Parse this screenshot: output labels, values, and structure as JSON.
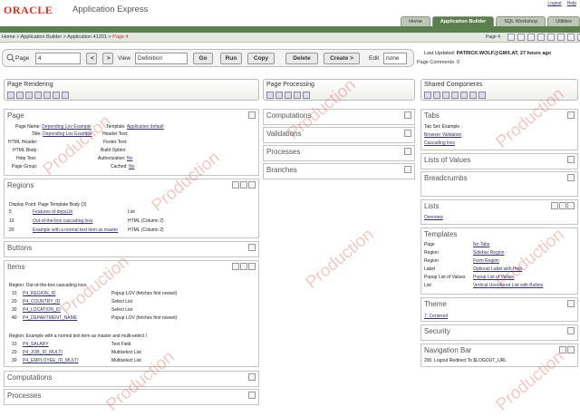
{
  "header": {
    "brand": "ORACLE",
    "app_title": "Application Express",
    "links": [
      "Logout",
      "Help"
    ],
    "tabs": [
      "Home",
      "Application Builder",
      "SQL Workshop",
      "Utilities"
    ]
  },
  "breadcrumb": {
    "path": "Home > Application Builder > Application 41201 >",
    "current": "Page 4",
    "page_tab": "Page 4"
  },
  "toolbar": {
    "page_label": "Page",
    "page_value": "4",
    "view_label": "View",
    "view_value": "Definition",
    "go": "Go",
    "run": "Run",
    "copy": "Copy",
    "delete": "Delete",
    "create": "Create >",
    "edit_label": "Edit",
    "edit_value": "none"
  },
  "status": {
    "last_updated_label": "Last Updated:",
    "last_updated": "PATRICK.WOLF@GMX.AT, 27 hours ago",
    "comments": "Page Comments: 0"
  },
  "page_rendering": {
    "title": "Page Rendering",
    "page": {
      "title": "Page",
      "name_label": "Page Name:",
      "name": "Depending Lov Example",
      "template_label": "Template:",
      "template": "Application default",
      "title_label": "Title:",
      "title_val": "Depending Lov Example",
      "header_text": "Header Text:",
      "html_header": "HTML Header:",
      "footer_text": "Footer Text:",
      "html_body": "HTML Body:",
      "build_option": "Build Option:",
      "help_text": "Help Text:",
      "authorization": "Authorization:",
      "auth_val": "No",
      "page_group": "Page Group:",
      "cached": "Cached:",
      "cached_val": "No"
    },
    "regions": {
      "title": "Regions",
      "display_point": "Display Point: Page Template Body (3)",
      "rows": [
        {
          "seq": "5",
          "name": "Features of depsLib",
          "type": "List"
        },
        {
          "seq": "10",
          "name": "Out-of-the-box cascading lovs",
          "type": "HTML (Column 2)"
        },
        {
          "seq": "20",
          "name": "Example with a normal text item as master",
          "type": "HTML (Column 2)"
        }
      ]
    },
    "buttons": {
      "title": "Buttons"
    },
    "items": {
      "title": "Items",
      "region1": "Region: Out-of-the-box cascading lovs",
      "rows1": [
        {
          "seq": "10",
          "name": "P4_REGION_ID",
          "type": "Popup LOV (fetches first rowset)"
        },
        {
          "seq": "20",
          "name": "P4_COUNTRY_ID",
          "type": "Select List"
        },
        {
          "seq": "30",
          "name": "P4_LOCATION_ID",
          "type": "Select List"
        },
        {
          "seq": "40",
          "name": "P4_DEPARTMENT_NAME",
          "type": "Popup LOV (fetches first rowset)"
        }
      ],
      "region2": "Region: Example with a normal text item as master and multi-select l",
      "rows2": [
        {
          "seq": "10",
          "name": "P4_SALARY",
          "type": "Text Field"
        },
        {
          "seq": "20",
          "name": "P4_JOB_ID_MULTI",
          "type": "Multiselect List"
        },
        {
          "seq": "30",
          "name": "P4_EMPLOYEE_ID_MULTI",
          "type": "Multiselect List"
        }
      ]
    },
    "computations": "Computations",
    "processes": "Processes"
  },
  "page_processing": {
    "title": "Page Processing",
    "sections": [
      "Computations",
      "Validations",
      "Processes",
      "Branches"
    ]
  },
  "shared": {
    "title": "Shared Components",
    "tabs": {
      "title": "Tabs",
      "set": "Tab Set: Example",
      "t1": "Browser Validation",
      "t2": "Cascading lovs"
    },
    "lov": "Lists of Values",
    "breadcrumbs": "Breadcrumbs",
    "lists": {
      "title": "Lists",
      "item": "Overview"
    },
    "templates": {
      "title": "Templates",
      "rows": [
        {
          "k": "Page",
          "v": "No Tabs"
        },
        {
          "k": "Region",
          "v": "Sidebar Region"
        },
        {
          "k": "Region",
          "v": "Form Region"
        },
        {
          "k": "Label",
          "v": "Optional Label with Help"
        },
        {
          "k": "Popup List of Values",
          "v": "Popup List of Values"
        },
        {
          "k": "List",
          "v": "Vertical Unordered List with Bullets"
        }
      ]
    },
    "theme": {
      "title": "Theme",
      "val": "7. Centered"
    },
    "security": "Security",
    "navbar": {
      "title": "Navigation Bar",
      "val": "200. Logout Redirect To $LOGOUT_URL"
    }
  },
  "watermark": "Production"
}
